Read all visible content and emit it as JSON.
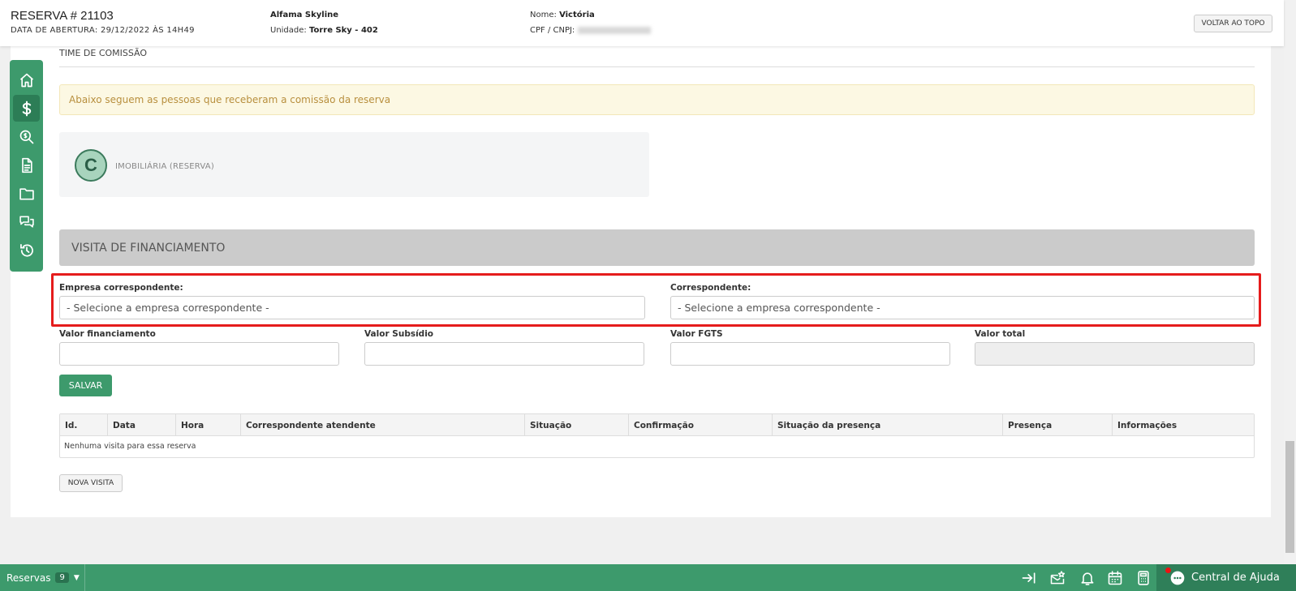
{
  "header": {
    "reserva_title": "RESERVA # 21103",
    "abertura": "DATA DE ABERTURA: 29/12/2022 ÀS 14H49",
    "empreendimento": "Alfama Skyline",
    "unidade_label": "Unidade:",
    "unidade_value": "Torre Sky - 402",
    "nome_label": "Nome:",
    "nome_value": "Victória",
    "cpf_label": "CPF / CNPJ:",
    "voltar_label": "VOLTAR AO TOPO"
  },
  "sidebar": {
    "items": [
      {
        "icon": "home-icon"
      },
      {
        "icon": "dollar-icon",
        "active": true
      },
      {
        "icon": "search-dollar-icon"
      },
      {
        "icon": "document-icon"
      },
      {
        "icon": "folder-icon"
      },
      {
        "icon": "chat-icon"
      },
      {
        "icon": "history-icon"
      }
    ]
  },
  "comissao": {
    "title": "TIME DE COMISSÃO",
    "alert": "Abaixo seguem as pessoas que receberam a comissão da reserva",
    "avatar_letter": "C",
    "role": "IMOBILIÁRIA (RESERVA)"
  },
  "visita": {
    "heading": "VISITA DE FINANCIAMENTO",
    "empresa_label": "Empresa correspondente:",
    "empresa_placeholder": "- Selecione a empresa correspondente -",
    "correspondente_label": "Correspondente:",
    "correspondente_placeholder": "- Selecione a empresa correspondente -",
    "valor_financiamento_label": "Valor financiamento",
    "valor_subsidio_label": "Valor Subsídio",
    "valor_fgts_label": "Valor FGTS",
    "valor_total_label": "Valor total",
    "salvar_label": "SALVAR",
    "table": {
      "columns": [
        "Id.",
        "Data",
        "Hora",
        "Correspondente atendente",
        "Situação",
        "Confirmação",
        "Situação da presença",
        "Presença",
        "Informações"
      ],
      "empty_message": "Nenhuma visita para essa reserva"
    },
    "nova_visita_label": "NOVA VISITA"
  },
  "footer": {
    "reservas_label": "Reservas",
    "reservas_count": "9",
    "help_label": "Central de Ajuda"
  },
  "colors": {
    "primary_green": "#3d9a6c",
    "highlight_red": "#e51c1c",
    "alert_bg": "#fcf8e3"
  }
}
